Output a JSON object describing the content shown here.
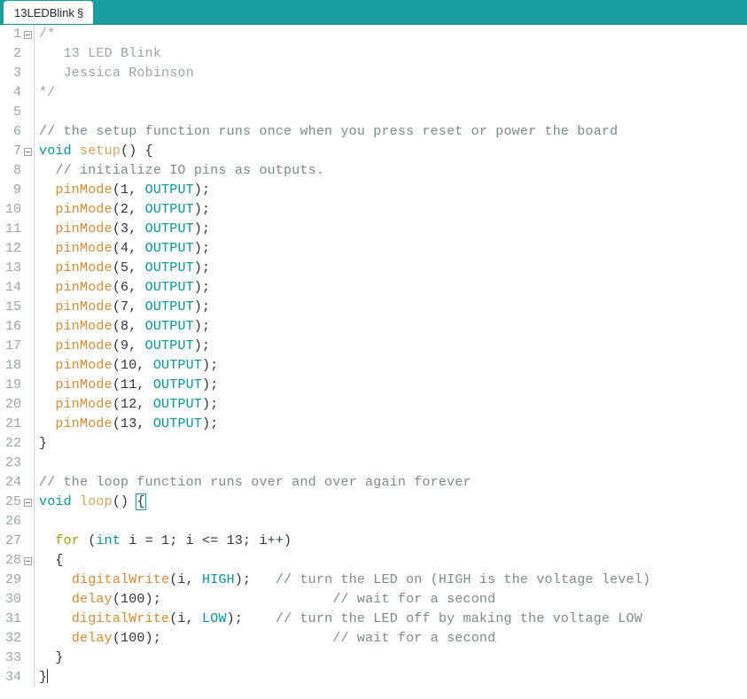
{
  "window": {
    "app": "Arduino IDE",
    "header_color": "#1a9e9e"
  },
  "tab": {
    "name": "13LEDBlink",
    "modified_marker": "§"
  },
  "editor": {
    "font": "monospace",
    "colors": {
      "comment_block": "#9aa5a5",
      "comment_line": "#7b8a8c",
      "keyword": "#00979c",
      "keyword_for": "#a1a100",
      "function_name": "#d7a35e",
      "function_call": "#d98a33",
      "constant": "#00979c",
      "plain": "#2e3436",
      "line_number": "#9aa5a5",
      "gutter_rule": "#cfd6d6"
    },
    "caret_line": 34,
    "fold_lines": [
      1,
      7,
      25,
      28
    ],
    "lines": [
      {
        "n": 1,
        "fold": true,
        "tokens": [
          {
            "t": "/*",
            "c": "t-cmt"
          }
        ]
      },
      {
        "n": 2,
        "fold": false,
        "tokens": [
          {
            "t": "   13 LED Blink",
            "c": "t-cmt"
          }
        ]
      },
      {
        "n": 3,
        "fold": false,
        "tokens": [
          {
            "t": "   Jessica Robinson",
            "c": "t-cmt"
          }
        ]
      },
      {
        "n": 4,
        "fold": false,
        "tokens": [
          {
            "t": "*/",
            "c": "t-cmt"
          }
        ]
      },
      {
        "n": 5,
        "fold": false,
        "tokens": []
      },
      {
        "n": 6,
        "fold": false,
        "tokens": [
          {
            "t": "// the setup function runs once when you press reset or power the board",
            "c": "t-cmt2"
          }
        ]
      },
      {
        "n": 7,
        "fold": true,
        "tokens": [
          {
            "t": "void",
            "c": "t-kw"
          },
          {
            "t": " ",
            "c": "t-plain"
          },
          {
            "t": "setup",
            "c": "t-fn"
          },
          {
            "t": "() {",
            "c": "t-plain"
          }
        ]
      },
      {
        "n": 8,
        "fold": false,
        "tokens": [
          {
            "t": "  // initialize IO pins as outputs.",
            "c": "t-cmt2"
          }
        ]
      },
      {
        "n": 9,
        "fold": false,
        "tokens": [
          {
            "t": "  ",
            "c": "t-plain"
          },
          {
            "t": "pinMode",
            "c": "t-call"
          },
          {
            "t": "(1, ",
            "c": "t-plain"
          },
          {
            "t": "OUTPUT",
            "c": "t-const"
          },
          {
            "t": ");",
            "c": "t-plain"
          }
        ]
      },
      {
        "n": 10,
        "fold": false,
        "tokens": [
          {
            "t": "  ",
            "c": "t-plain"
          },
          {
            "t": "pinMode",
            "c": "t-call"
          },
          {
            "t": "(2, ",
            "c": "t-plain"
          },
          {
            "t": "OUTPUT",
            "c": "t-const"
          },
          {
            "t": ");",
            "c": "t-plain"
          }
        ]
      },
      {
        "n": 11,
        "fold": false,
        "tokens": [
          {
            "t": "  ",
            "c": "t-plain"
          },
          {
            "t": "pinMode",
            "c": "t-call"
          },
          {
            "t": "(3, ",
            "c": "t-plain"
          },
          {
            "t": "OUTPUT",
            "c": "t-const"
          },
          {
            "t": ");",
            "c": "t-plain"
          }
        ]
      },
      {
        "n": 12,
        "fold": false,
        "tokens": [
          {
            "t": "  ",
            "c": "t-plain"
          },
          {
            "t": "pinMode",
            "c": "t-call"
          },
          {
            "t": "(4, ",
            "c": "t-plain"
          },
          {
            "t": "OUTPUT",
            "c": "t-const"
          },
          {
            "t": ");",
            "c": "t-plain"
          }
        ]
      },
      {
        "n": 13,
        "fold": false,
        "tokens": [
          {
            "t": "  ",
            "c": "t-plain"
          },
          {
            "t": "pinMode",
            "c": "t-call"
          },
          {
            "t": "(5, ",
            "c": "t-plain"
          },
          {
            "t": "OUTPUT",
            "c": "t-const"
          },
          {
            "t": ");",
            "c": "t-plain"
          }
        ]
      },
      {
        "n": 14,
        "fold": false,
        "tokens": [
          {
            "t": "  ",
            "c": "t-plain"
          },
          {
            "t": "pinMode",
            "c": "t-call"
          },
          {
            "t": "(6, ",
            "c": "t-plain"
          },
          {
            "t": "OUTPUT",
            "c": "t-const"
          },
          {
            "t": ");",
            "c": "t-plain"
          }
        ]
      },
      {
        "n": 15,
        "fold": false,
        "tokens": [
          {
            "t": "  ",
            "c": "t-plain"
          },
          {
            "t": "pinMode",
            "c": "t-call"
          },
          {
            "t": "(7, ",
            "c": "t-plain"
          },
          {
            "t": "OUTPUT",
            "c": "t-const"
          },
          {
            "t": ");",
            "c": "t-plain"
          }
        ]
      },
      {
        "n": 16,
        "fold": false,
        "tokens": [
          {
            "t": "  ",
            "c": "t-plain"
          },
          {
            "t": "pinMode",
            "c": "t-call"
          },
          {
            "t": "(8, ",
            "c": "t-plain"
          },
          {
            "t": "OUTPUT",
            "c": "t-const"
          },
          {
            "t": ");",
            "c": "t-plain"
          }
        ]
      },
      {
        "n": 17,
        "fold": false,
        "tokens": [
          {
            "t": "  ",
            "c": "t-plain"
          },
          {
            "t": "pinMode",
            "c": "t-call"
          },
          {
            "t": "(9, ",
            "c": "t-plain"
          },
          {
            "t": "OUTPUT",
            "c": "t-const"
          },
          {
            "t": ");",
            "c": "t-plain"
          }
        ]
      },
      {
        "n": 18,
        "fold": false,
        "tokens": [
          {
            "t": "  ",
            "c": "t-plain"
          },
          {
            "t": "pinMode",
            "c": "t-call"
          },
          {
            "t": "(10, ",
            "c": "t-plain"
          },
          {
            "t": "OUTPUT",
            "c": "t-const"
          },
          {
            "t": ");",
            "c": "t-plain"
          }
        ]
      },
      {
        "n": 19,
        "fold": false,
        "tokens": [
          {
            "t": "  ",
            "c": "t-plain"
          },
          {
            "t": "pinMode",
            "c": "t-call"
          },
          {
            "t": "(11, ",
            "c": "t-plain"
          },
          {
            "t": "OUTPUT",
            "c": "t-const"
          },
          {
            "t": ");",
            "c": "t-plain"
          }
        ]
      },
      {
        "n": 20,
        "fold": false,
        "tokens": [
          {
            "t": "  ",
            "c": "t-plain"
          },
          {
            "t": "pinMode",
            "c": "t-call"
          },
          {
            "t": "(12, ",
            "c": "t-plain"
          },
          {
            "t": "OUTPUT",
            "c": "t-const"
          },
          {
            "t": ");",
            "c": "t-plain"
          }
        ]
      },
      {
        "n": 21,
        "fold": false,
        "tokens": [
          {
            "t": "  ",
            "c": "t-plain"
          },
          {
            "t": "pinMode",
            "c": "t-call"
          },
          {
            "t": "(13, ",
            "c": "t-plain"
          },
          {
            "t": "OUTPUT",
            "c": "t-const"
          },
          {
            "t": ");",
            "c": "t-plain"
          }
        ]
      },
      {
        "n": 22,
        "fold": false,
        "tokens": [
          {
            "t": "}",
            "c": "t-plain"
          }
        ]
      },
      {
        "n": 23,
        "fold": false,
        "tokens": []
      },
      {
        "n": 24,
        "fold": false,
        "tokens": [
          {
            "t": "// the loop function runs over and over again forever",
            "c": "t-cmt2"
          }
        ]
      },
      {
        "n": 25,
        "fold": true,
        "tokens": [
          {
            "t": "void",
            "c": "t-kw"
          },
          {
            "t": " ",
            "c": "t-plain"
          },
          {
            "t": "loop",
            "c": "t-fn"
          },
          {
            "t": "() ",
            "c": "t-plain"
          },
          {
            "t": "{",
            "c": "t-plain brace-match"
          }
        ]
      },
      {
        "n": 26,
        "fold": false,
        "tokens": []
      },
      {
        "n": 27,
        "fold": false,
        "tokens": [
          {
            "t": "  ",
            "c": "t-plain"
          },
          {
            "t": "for",
            "c": "t-kw2"
          },
          {
            "t": " (",
            "c": "t-plain"
          },
          {
            "t": "int",
            "c": "t-kw"
          },
          {
            "t": " i = 1; i <= 13; i++)",
            "c": "t-plain"
          }
        ]
      },
      {
        "n": 28,
        "fold": true,
        "tokens": [
          {
            "t": "  {",
            "c": "t-plain"
          }
        ]
      },
      {
        "n": 29,
        "fold": false,
        "tokens": [
          {
            "t": "    ",
            "c": "t-plain"
          },
          {
            "t": "digitalWrite",
            "c": "t-call"
          },
          {
            "t": "(i, ",
            "c": "t-plain"
          },
          {
            "t": "HIGH",
            "c": "t-const"
          },
          {
            "t": ");   ",
            "c": "t-plain"
          },
          {
            "t": "// turn the LED on (HIGH is the voltage level)",
            "c": "t-cmt2"
          }
        ]
      },
      {
        "n": 30,
        "fold": false,
        "tokens": [
          {
            "t": "    ",
            "c": "t-plain"
          },
          {
            "t": "delay",
            "c": "t-call"
          },
          {
            "t": "(100);                     ",
            "c": "t-plain"
          },
          {
            "t": "// wait for a second",
            "c": "t-cmt2"
          }
        ]
      },
      {
        "n": 31,
        "fold": false,
        "tokens": [
          {
            "t": "    ",
            "c": "t-plain"
          },
          {
            "t": "digitalWrite",
            "c": "t-call"
          },
          {
            "t": "(i, ",
            "c": "t-plain"
          },
          {
            "t": "LOW",
            "c": "t-const"
          },
          {
            "t": ");    ",
            "c": "t-plain"
          },
          {
            "t": "// turn the LED off by making the voltage LOW",
            "c": "t-cmt2"
          }
        ]
      },
      {
        "n": 32,
        "fold": false,
        "tokens": [
          {
            "t": "    ",
            "c": "t-plain"
          },
          {
            "t": "delay",
            "c": "t-call"
          },
          {
            "t": "(100);                     ",
            "c": "t-plain"
          },
          {
            "t": "// wait for a second",
            "c": "t-cmt2"
          }
        ]
      },
      {
        "n": 33,
        "fold": false,
        "tokens": [
          {
            "t": "  }",
            "c": "t-plain"
          }
        ]
      },
      {
        "n": 34,
        "fold": false,
        "tokens": [
          {
            "t": "}",
            "c": "t-plain"
          }
        ],
        "caret": true
      }
    ]
  }
}
